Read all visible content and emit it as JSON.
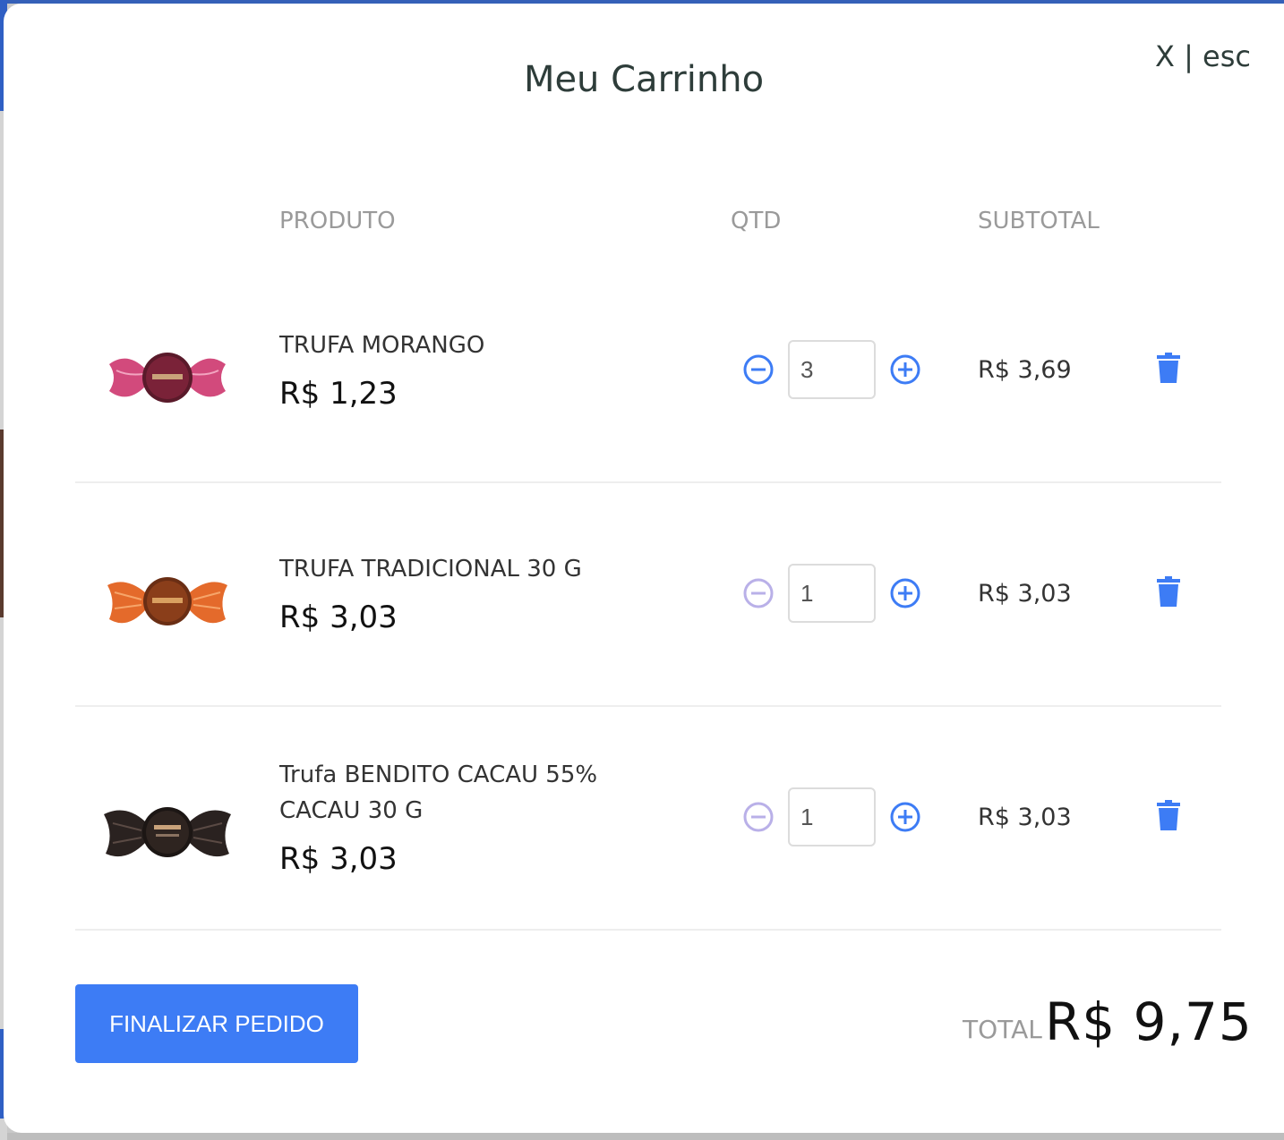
{
  "modal": {
    "title": "Meu Carrinho",
    "close_label": "X | esc"
  },
  "columns": {
    "product": "PRODUTO",
    "qty": "QTD",
    "subtotal": "SUBTOTAL"
  },
  "items": [
    {
      "name": "TRUFA MORANGO",
      "price": "R$ 1,23",
      "qty": "3",
      "subtotal": "R$ 3,69",
      "wrapper_color": "#c7406e",
      "image_icon": "truffle-strawberry-image",
      "minus_enabled": true
    },
    {
      "name": "TRUFA TRADICIONAL 30 G",
      "price": "R$ 3,03",
      "qty": "1",
      "subtotal": "R$ 3,03",
      "wrapper_color": "#d9622a",
      "image_icon": "truffle-traditional-image",
      "minus_enabled": false
    },
    {
      "name_line1": "Trufa BENDITO CACAU 55%",
      "name_line2": "CACAU 30 G",
      "price": "R$ 3,03",
      "qty": "1",
      "subtotal": "R$ 3,03",
      "wrapper_color": "#2a2220",
      "image_icon": "truffle-cacao-image",
      "minus_enabled": false
    }
  ],
  "footer": {
    "finalize_label": "FINALIZAR PEDIDO",
    "total_label": "TOTAL",
    "total_value": "R$ 9,75"
  },
  "colors": {
    "accent": "#3d7cf5",
    "minus_active": "#3d7cf5",
    "minus_disabled": "#b9b0e8",
    "trash": "#3d7cf5",
    "heading": "#2e3d3a"
  }
}
